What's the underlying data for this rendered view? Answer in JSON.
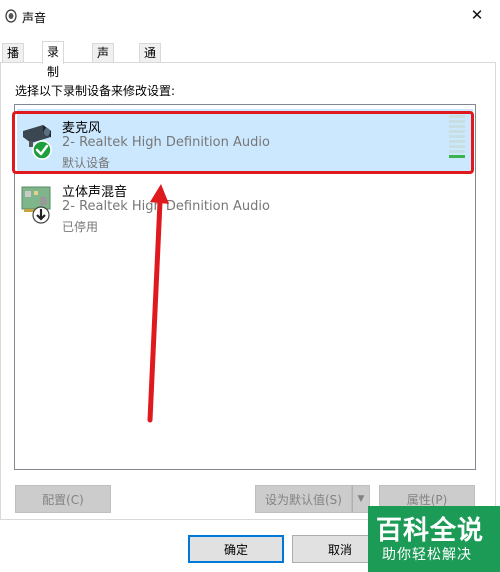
{
  "window": {
    "title": "声音",
    "close_glyph": "✕"
  },
  "tabs": [
    {
      "label": "播放"
    },
    {
      "label": "录制"
    },
    {
      "label": "声音"
    },
    {
      "label": "通信"
    }
  ],
  "instruction": "选择以下录制设备来修改设置:",
  "devices": [
    {
      "name": "麦克风",
      "driver": "2- Realtek High Definition Audio",
      "status": "默认设备",
      "icon": "microphone-icon",
      "badge": "default-check-icon",
      "level": 0.1
    },
    {
      "name": "立体声混音",
      "driver": "2- Realtek High Definition Audio",
      "status": "已停用",
      "icon": "sound-card-icon",
      "badge": "disabled-arrow-icon"
    }
  ],
  "buttons": {
    "configure": "配置(C)",
    "set_default": "设为默认值(S)",
    "properties": "属性(P)",
    "ok": "确定",
    "cancel": "取消"
  },
  "watermark": {
    "main": "百科全说",
    "sub": "助你轻松解决"
  },
  "colors": {
    "highlight_red": "#e0191f",
    "check_green": "#1e9e3e",
    "watermark_green": "#1c9b56",
    "focus_blue": "#0078d7"
  }
}
